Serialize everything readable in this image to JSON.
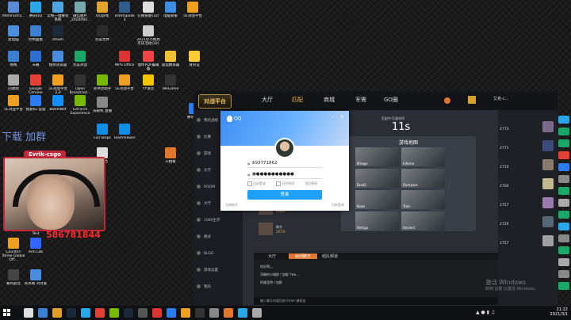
{
  "desktop_icons": [
    {
      "label": "Administra...",
      "color": "#5b8ad6"
    },
    {
      "label": "腾讯QQ",
      "color": "#2aa7e8"
    },
    {
      "label": "云帆一键重装系统",
      "color": "#4fa3e0"
    },
    {
      "label": "微信图片_2020092...",
      "color": "#7aa"
    },
    {
      "label": "QQ游戏",
      "color": "#e0a52a"
    },
    {
      "label": "TeamSpeak 3",
      "color": "#2f5c8a"
    },
    {
      "label": "在网管助(32)",
      "color": "#ddd"
    },
    {
      "label": "电脑管家",
      "color": "#3a8ee6"
    },
    {
      "label": "5E对战平台",
      "color": "#f0a020"
    },
    {
      "label": "此电脑",
      "color": "#4b8fe0"
    },
    {
      "label": "控制面板",
      "color": "#3b7fd0"
    },
    {
      "label": "steam",
      "color": "#1b2838"
    },
    {
      "label": "完美世界",
      "color": "#2b2b2b"
    },
    {
      "label": "2021年小熊周年庆活动(32)",
      "color": "#ccc"
    },
    {
      "label": "网络",
      "color": "#3b7fd0"
    },
    {
      "label": "天籁",
      "color": "#2c6fd1"
    },
    {
      "label": "搜狗浏览器",
      "color": "#4a8de0"
    },
    {
      "label": "完美对战",
      "color": "#1aa86a"
    },
    {
      "label": "WPS Office",
      "color": "#d33"
    },
    {
      "label": "福昕PDF编辑器",
      "color": "#e44"
    },
    {
      "label": "雷电模拟器",
      "color": "#f2c230"
    },
    {
      "label": "身份证",
      "color": "#ffcc33"
    },
    {
      "label": "回收站",
      "color": "#aaa"
    },
    {
      "label": "Google Chrome",
      "color": "#e34133"
    },
    {
      "label": "5E对战平台 2.0",
      "color": "#f0a020"
    },
    {
      "label": "Open Broadcast...",
      "color": "#333"
    },
    {
      "label": "英伟达助手",
      "color": "#76b900"
    },
    {
      "label": "5E对战平台",
      "color": "#f0a020"
    },
    {
      "label": "YY语音",
      "color": "#f5c400"
    },
    {
      "label": "WeGame",
      "color": "#333"
    },
    {
      "label": "腾讯会议",
      "color": "#2b7cf0"
    },
    {
      "label": "TeamViewer",
      "color": "#0e8ee9"
    },
    {
      "label": "Full Steps",
      "color": "#0e8ee9"
    },
    {
      "label": "5E对战平台",
      "color": "#f0a020"
    },
    {
      "label": "GeForce Experience",
      "color": "#76b900"
    },
    {
      "label": "BattleNet",
      "color": "#148eff"
    },
    {
      "label": "我爱Ku 远程",
      "color": "#2b7cf0"
    },
    {
      "label": "洗碗机 直播",
      "color": "#888"
    },
    {
      "label": "网易云音乐",
      "color": "#d33"
    },
    {
      "label": "Smartfool Test",
      "color": "#c33"
    },
    {
      "label": "Counter-Strike Global Off...",
      "color": "#f0a020"
    },
    {
      "label": "Aim Lab",
      "color": "#2e66ff"
    },
    {
      "label": "暴风影音",
      "color": "#444"
    },
    {
      "label": "英英网 对对爱",
      "color": "#4a8de0"
    },
    {
      "label": "本文档",
      "color": "#ddd"
    },
    {
      "label": "只拍板",
      "color": "#e2762c"
    }
  ],
  "webcam": {
    "nametag": "Evrik-csgo",
    "number": "586781844",
    "overlay": "下载 加群"
  },
  "client": {
    "logo": "对战平台",
    "nav": [
      "大厅",
      "匹配",
      "商城",
      "军需",
      "GO圈"
    ],
    "nav_active": 1,
    "sidebar": [
      "我的战绩",
      "比赛",
      "游戏",
      "大厅",
      "ROOM",
      "大厅",
      "1000生存",
      "模式",
      "BLOG",
      "游戏设置",
      "我的"
    ],
    "timer_label": "匹配中 匹配时间",
    "timer": "11s",
    "map_title": "游戏地图",
    "maps": [
      "Mirage",
      "Inferno",
      "Dust2",
      "Overpass",
      "Nuke",
      "Train",
      "Vertigo",
      "Ancient"
    ],
    "mid_list": [
      {
        "title": "排位名",
        "name": "2665"
      },
      {
        "title": "剩余",
        "name": "2670"
      }
    ],
    "players": [
      {
        "name": "...",
        "score": "2773"
      },
      {
        "name": "...",
        "score": "2771"
      },
      {
        "name": "...",
        "score": "2710"
      },
      {
        "name": "...",
        "score": "2700"
      },
      {
        "name": "...",
        "score": "2757"
      },
      {
        "name": "...",
        "score": "2720"
      },
      {
        "name": "...",
        "score": "2757"
      }
    ],
    "chat_tabs": [
      "大厅",
      "房间聊天",
      "组队频道"
    ],
    "chat_active": 1,
    "chat_lines": [
      "你好啊,,, ",
      "顶端的小城群 / 加群 Ywa...",
      "阿维里特 / 加群"
    ],
    "chat_input_placeholder": "输入聊天内容后按 Enter 键发送",
    "top_user": "艾克-c..."
  },
  "qq_login": {
    "brand": "QQ",
    "account": "593771862",
    "password": "●●●●●●●●●●●",
    "opt1": "自动登录",
    "opt2": "记住密码",
    "opt3": "找回密码",
    "login_label": "登录",
    "footer_left": "注册帐号",
    "footer_right": "扫码登录"
  },
  "watermark": {
    "line1": "激活 Windows",
    "line2": "转到'设置'以激活 Windows。"
  },
  "clock": {
    "time": "21:22",
    "date": "2021/3/1"
  }
}
